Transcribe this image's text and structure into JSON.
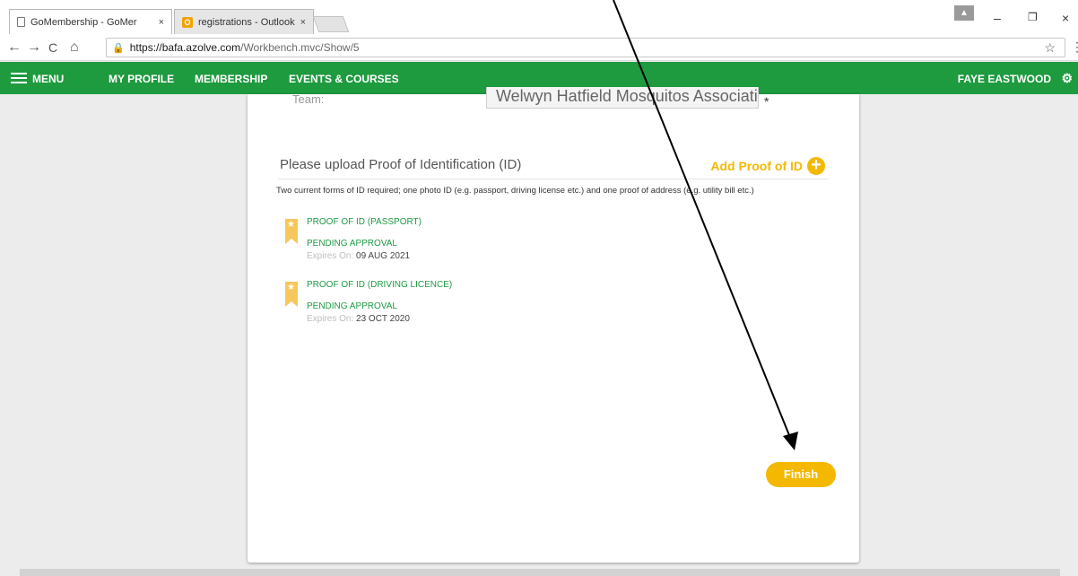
{
  "browser": {
    "tabs": [
      {
        "label": "GoMembership - GoMer",
        "close": "×"
      },
      {
        "label": "registrations - Outlook W",
        "close": "×"
      }
    ],
    "outlook_glyph": "O",
    "url_host": "https://bafa.azolve.com",
    "url_path": "/Workbench.mvc/Show/5",
    "nav": {
      "back": "←",
      "forward": "→",
      "reload": "C",
      "home": "⌂"
    },
    "window": {
      "minimize": "–",
      "maximize": "❐",
      "close": "×"
    },
    "star": "☆",
    "menu_dots": "⋮"
  },
  "navbar": {
    "menu": "MENU",
    "items": [
      "MY PROFILE",
      "MEMBERSHIP",
      "EVENTS & COURSES"
    ],
    "user": "FAYE EASTWOOD",
    "color": "#1e9a3f"
  },
  "form": {
    "team_label": "Team:",
    "team_value": "Welwyn Hatfield Mosquitos Associati",
    "required_mark": "*"
  },
  "upload": {
    "title": "Please upload Proof of Identification (ID)",
    "add_label": "Add Proof of ID",
    "add_icon": "+",
    "description": "Two current forms of ID required; one photo ID (e.g. passport, driving license etc.) and one proof of address (e.g. utility bill etc.)",
    "expires_label": "Expires On:",
    "documents": [
      {
        "title": "PROOF OF ID (PASSPORT)",
        "status": "PENDING APPROVAL",
        "expires": "09 AUG 2021"
      },
      {
        "title": "PROOF OF ID (DRIVING LICENCE)",
        "status": "PENDING APPROVAL",
        "expires": "23 OCT 2020"
      }
    ]
  },
  "finish_label": "Finish",
  "accent": "#f5b800"
}
